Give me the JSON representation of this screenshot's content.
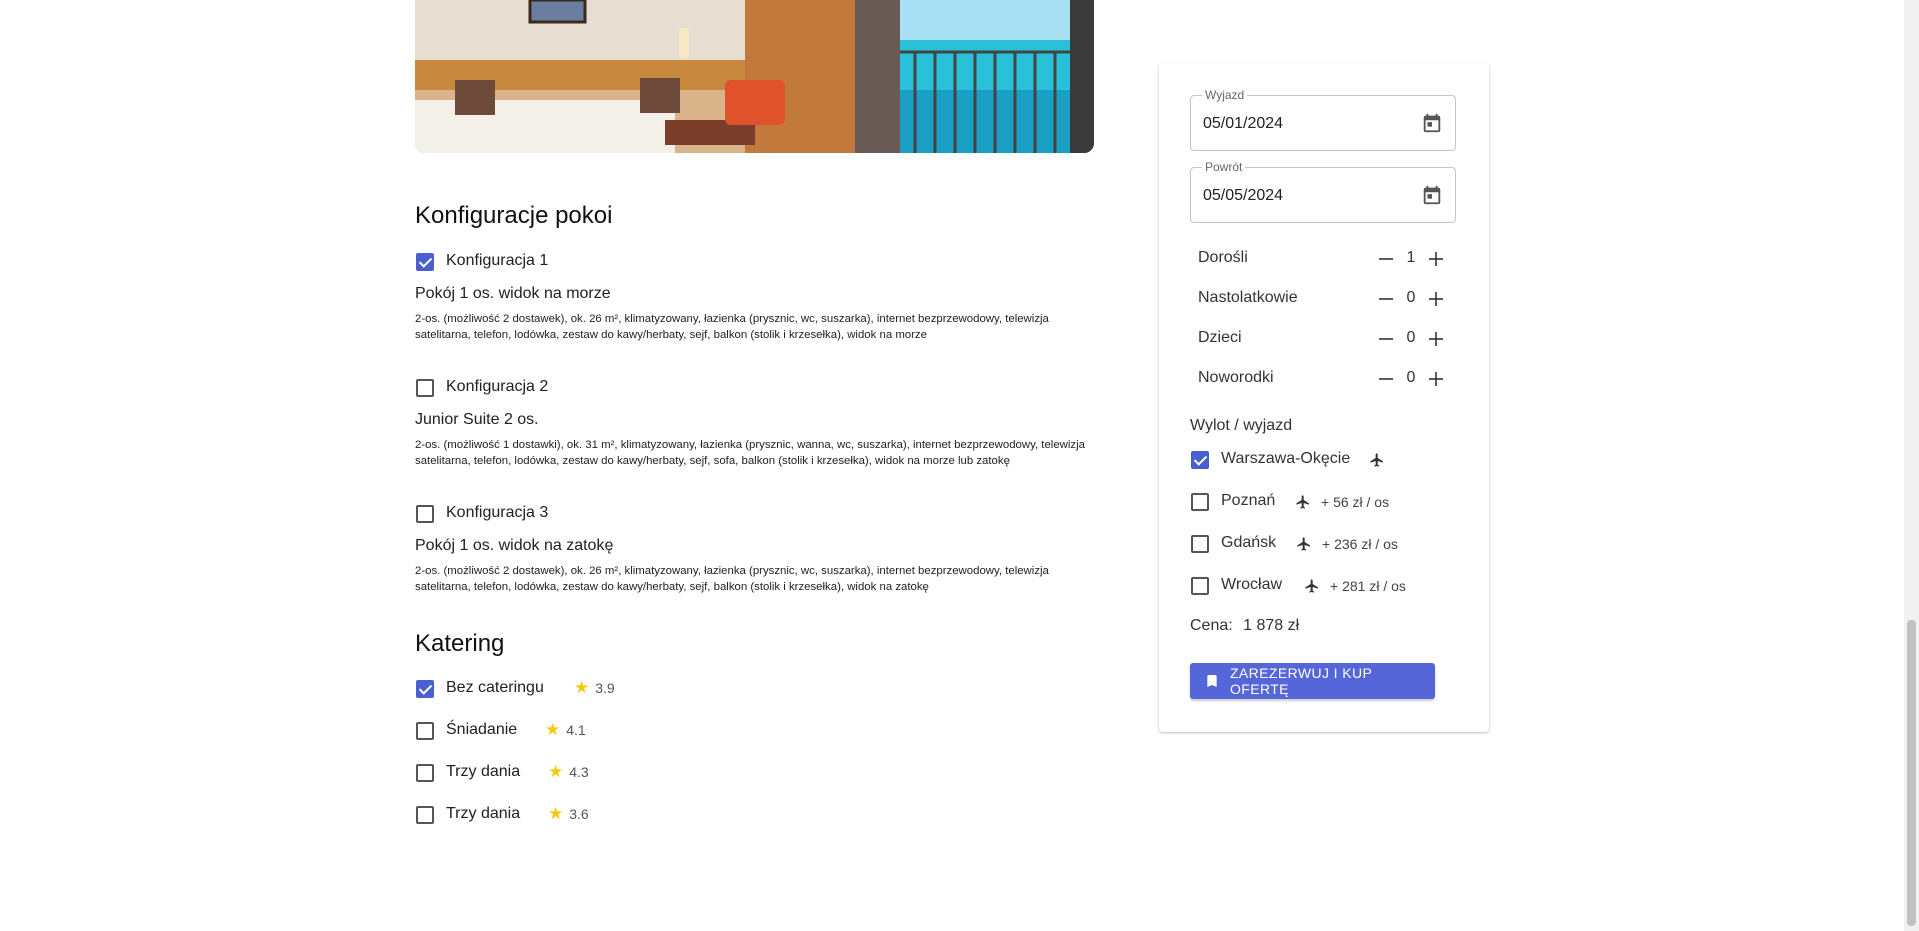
{
  "rooms": {
    "title": "Konfiguracje pokoi",
    "configs": [
      {
        "label": "Konfiguracja 1",
        "checked": true,
        "room_name": "Pokój 1 os. widok na morze",
        "description": "2-os. (możliwość 2 dostawek), ok. 26 m², klimatyzowany, łazienka (prysznic, wc, suszarka), internet bezprzewodowy, telewizja satelitarna, telefon, lodówka, zestaw do kawy/herbaty, sejf, balkon (stolik i krzesełka), widok na morze"
      },
      {
        "label": "Konfiguracja 2",
        "checked": false,
        "room_name": "Junior Suite 2 os.",
        "description": "2-os. (możliwość 1 dostawki), ok. 31 m², klimatyzowany, łazienka (prysznic, wanna, wc, suszarka), internet bezprzewodowy, telewizja satelitarna, telefon, lodówka, zestaw do kawy/herbaty, sejf, sofa, balkon (stolik i krzesełka), widok na morze lub zatokę"
      },
      {
        "label": "Konfiguracja 3",
        "checked": false,
        "room_name": "Pokój 1 os. widok na zatokę",
        "description": "2-os. (możliwość 2 dostawek), ok. 26 m², klimatyzowany, łazienka (prysznic, wc, suszarka), internet bezprzewodowy, telewizja satelitarna, telefon, lodówka, zestaw do kawy/herbaty, sejf, balkon (stolik i krzesełka), widok na zatokę"
      }
    ]
  },
  "catering": {
    "title": "Katering",
    "options": [
      {
        "label": "Bez cateringu",
        "checked": true,
        "rating": "3.9"
      },
      {
        "label": "Śniadanie",
        "checked": false,
        "rating": "4.1"
      },
      {
        "label": "Trzy dania",
        "checked": false,
        "rating": "4.3"
      },
      {
        "label": "Trzy dania",
        "checked": false,
        "rating": "3.6"
      }
    ]
  },
  "booking": {
    "departure_date": {
      "label": "Wyjazd",
      "value": "05/01/2024"
    },
    "return_date": {
      "label": "Powrót",
      "value": "05/05/2024"
    },
    "travelers": [
      {
        "label": "Dorośli",
        "count": "1"
      },
      {
        "label": "Nastolatkowie",
        "count": "0"
      },
      {
        "label": "Dzieci",
        "count": "0"
      },
      {
        "label": "Noworodki",
        "count": "0"
      }
    ],
    "departure_title": "Wylot / wyjazd",
    "airports": [
      {
        "label": "Warszawa-Okęcie",
        "checked": true,
        "price": ""
      },
      {
        "label": "Poznań",
        "checked": false,
        "price": "+ 56 zł / os"
      },
      {
        "label": "Gdańsk",
        "checked": false,
        "price": "+ 236 zł / os"
      },
      {
        "label": "Wrocław",
        "checked": false,
        "price": "+ 281 zł / os"
      }
    ],
    "price_label": "Cena:",
    "price_value": "1 878 zł",
    "cta_label": "ZAREZERWUJ I KUP OFERTĘ"
  },
  "colors": {
    "accent": "#4a5fd0",
    "star": "#f6c90e"
  }
}
